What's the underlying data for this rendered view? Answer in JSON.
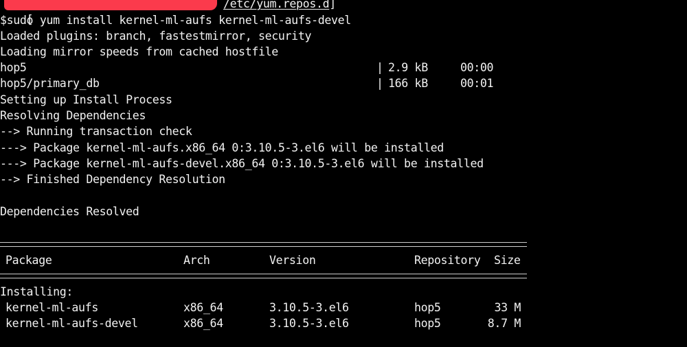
{
  "terminal": {
    "prompt": {
      "open_bracket": "[",
      "path": "/etc/yum.repos.d",
      "close_bracket": "]",
      "redaction_color": "#fb3a4c"
    },
    "command": "$sudo yum install kernel-ml-aufs kernel-ml-aufs-devel",
    "output_lines": [
      "Loaded plugins: branch, fastestmirror, security",
      "Loading mirror speeds from cached hostfile"
    ],
    "downloads": [
      {
        "name": "hop5",
        "sep": "|",
        "size": "2.9 kB",
        "time": "00:00"
      },
      {
        "name": "hop5/primary_db",
        "sep": "|",
        "size": "166 kB",
        "time": "00:01"
      }
    ],
    "resolution_lines": [
      "Setting up Install Process",
      "Resolving Dependencies",
      "--> Running transaction check",
      "---> Package kernel-ml-aufs.x86_64 0:3.10.5-3.el6 will be installed",
      "---> Package kernel-ml-aufs-devel.x86_64 0:3.10.5-3.el6 will be installed",
      "--> Finished Dependency Resolution",
      "",
      "Dependencies Resolved"
    ],
    "table": {
      "headers": {
        "package": "Package",
        "arch": "Arch",
        "version": "Version",
        "repository": "Repository",
        "size": "Size"
      },
      "section_label": "Installing:",
      "rows": [
        {
          "package": "kernel-ml-aufs",
          "arch": "x86_64",
          "version": "3.10.5-3.el6",
          "repository": "hop5",
          "size": "33 M"
        },
        {
          "package": "kernel-ml-aufs-devel",
          "arch": "x86_64",
          "version": "3.10.5-3.el6",
          "repository": "hop5",
          "size": "8.7 M"
        }
      ]
    }
  }
}
